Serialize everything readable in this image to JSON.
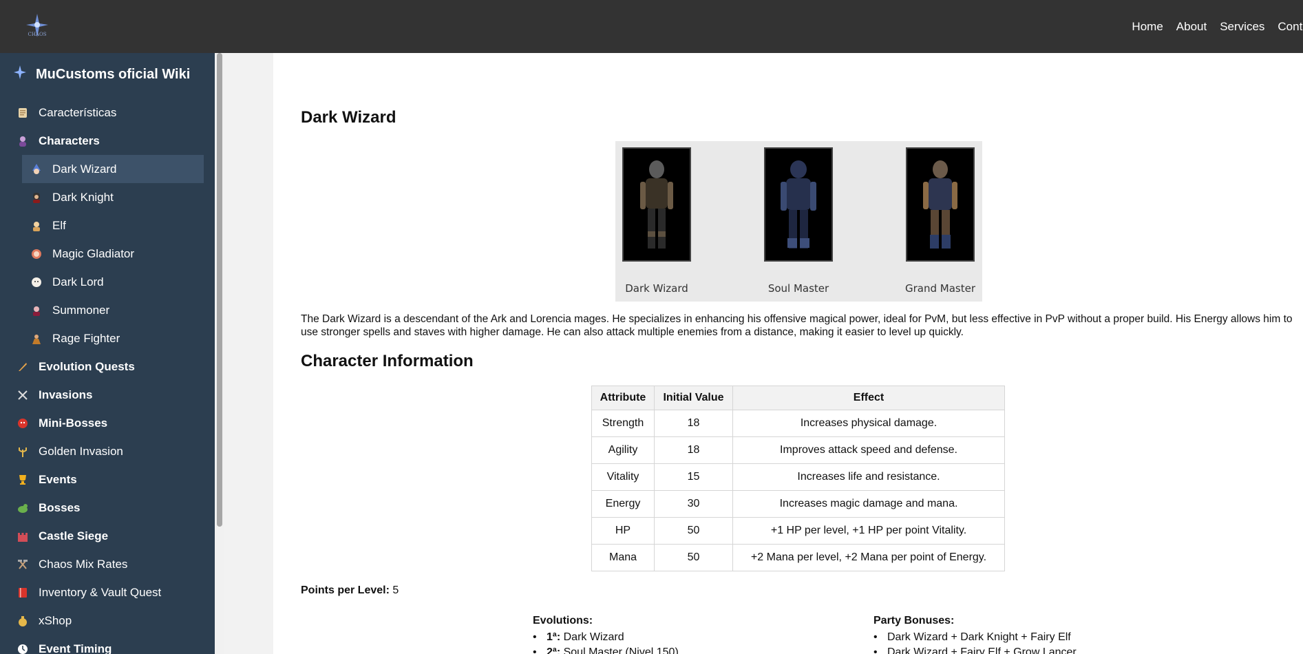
{
  "topbar": {
    "nav": [
      "Home",
      "About",
      "Services",
      "Contact"
    ]
  },
  "sidebar": {
    "title": "MuCustoms oficial Wiki",
    "items": [
      {
        "label": "Características",
        "icon": "scroll-icon",
        "level": "top",
        "bold": false
      },
      {
        "label": "Characters",
        "icon": "character-icon",
        "level": "top",
        "bold": true
      },
      {
        "label": "Dark Wizard",
        "icon": "wizard-icon",
        "level": "sub",
        "bold": false,
        "active": true
      },
      {
        "label": "Dark Knight",
        "icon": "knight-icon",
        "level": "sub",
        "bold": false
      },
      {
        "label": "Elf",
        "icon": "elf-icon",
        "level": "sub",
        "bold": false
      },
      {
        "label": "Magic Gladiator",
        "icon": "gladiator-icon",
        "level": "sub",
        "bold": false
      },
      {
        "label": "Dark Lord",
        "icon": "lord-icon",
        "level": "sub",
        "bold": false
      },
      {
        "label": "Summoner",
        "icon": "summoner-icon",
        "level": "sub",
        "bold": false
      },
      {
        "label": "Rage Fighter",
        "icon": "fighter-icon",
        "level": "sub",
        "bold": false
      },
      {
        "label": "Evolution Quests",
        "icon": "quill-icon",
        "level": "top",
        "bold": true
      },
      {
        "label": "Invasions",
        "icon": "crossed-swords-icon",
        "level": "top",
        "bold": true
      },
      {
        "label": "Mini-Bosses",
        "icon": "ogre-icon",
        "level": "top",
        "bold": true
      },
      {
        "label": "Golden Invasion",
        "icon": "trident-icon",
        "level": "top",
        "bold": false
      },
      {
        "label": "Events",
        "icon": "trophy-icon",
        "level": "top",
        "bold": true
      },
      {
        "label": "Bosses",
        "icon": "dragon-icon",
        "level": "top",
        "bold": true
      },
      {
        "label": "Castle Siege",
        "icon": "castle-icon",
        "level": "top",
        "bold": true
      },
      {
        "label": "Chaos Mix Rates",
        "icon": "hammer-pick-icon",
        "level": "top",
        "bold": false
      },
      {
        "label": "Inventory & Vault Quest",
        "icon": "book-icon",
        "level": "top",
        "bold": false
      },
      {
        "label": "xShop",
        "icon": "money-bag-icon",
        "level": "top",
        "bold": false
      },
      {
        "label": "Event Timing",
        "icon": "clock-icon",
        "level": "top",
        "bold": true
      }
    ]
  },
  "main": {
    "title": "Dark Wizard",
    "gallery": [
      {
        "caption": "Dark Wizard"
      },
      {
        "caption": "Soul Master"
      },
      {
        "caption": "Grand Master"
      }
    ],
    "description": "The Dark Wizard is a descendant of the Ark and Lorencia mages. He specializes in enhancing his offensive magical power, ideal for PvM, but less effective in PvP without a proper build. His Energy allows him to use stronger spells and staves with higher damage. He can also attack multiple enemies from a distance, making it easier to level up quickly.",
    "info_title": "Character Information",
    "table": {
      "headers": [
        "Attribute",
        "Initial Value",
        "Effect"
      ],
      "rows": [
        [
          "Strength",
          "18",
          "Increases physical damage."
        ],
        [
          "Agility",
          "18",
          "Improves attack speed and defense."
        ],
        [
          "Vitality",
          "15",
          "Increases life and resistance."
        ],
        [
          "Energy",
          "30",
          "Increases magic damage and mana."
        ],
        [
          "HP",
          "50",
          "+1 HP per level, +1 HP per point Vitality."
        ],
        [
          "Mana",
          "50",
          "+2 Mana per level, +2 Mana per point of Energy."
        ]
      ]
    },
    "points_label": "Points per Level:",
    "points_value": "5",
    "evolutions": {
      "title": "Evolutions:",
      "items": [
        {
          "key": "1ª:",
          "value": "Dark Wizard"
        },
        {
          "key": "2ª:",
          "value": "Soul Master (Nivel 150)"
        }
      ]
    },
    "party": {
      "title": "Party Bonuses:",
      "items": [
        "Dark Wizard + Dark Knight + Fairy Elf",
        "Dark Wizard + Fairy Elf + Grow Lancer"
      ]
    }
  }
}
